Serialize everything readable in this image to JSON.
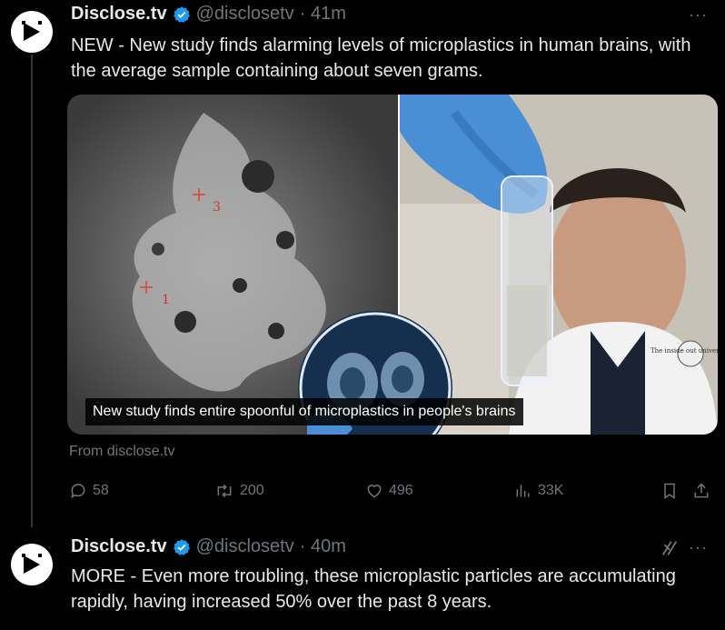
{
  "tweets": [
    {
      "name": "Disclose.tv",
      "handle": "@disclosetv",
      "time": "· 41m",
      "text": "NEW - New study finds alarming levels of microplastics in human brains, with the average sample containing about seven grams.",
      "media_caption": "New study finds entire spoonful of microplastics in people's brains",
      "media_labels": [
        "3",
        "1"
      ],
      "media_watermark": "The inside out universe",
      "link_source": "From disclose.tv",
      "actions": {
        "replies": "58",
        "reposts": "200",
        "likes": "496",
        "views": "33K"
      }
    },
    {
      "name": "Disclose.tv",
      "handle": "@disclosetv",
      "time": "· 40m",
      "text": "MORE - Even more troubling, these microplastic particles are accumulating rapidly, having increased 50% over the past 8 years."
    }
  ],
  "more_label": "···",
  "colors": {
    "verified": "#1d9bf0",
    "muted": "#71767b",
    "text": "#e7e9ea",
    "background": "#000000"
  }
}
